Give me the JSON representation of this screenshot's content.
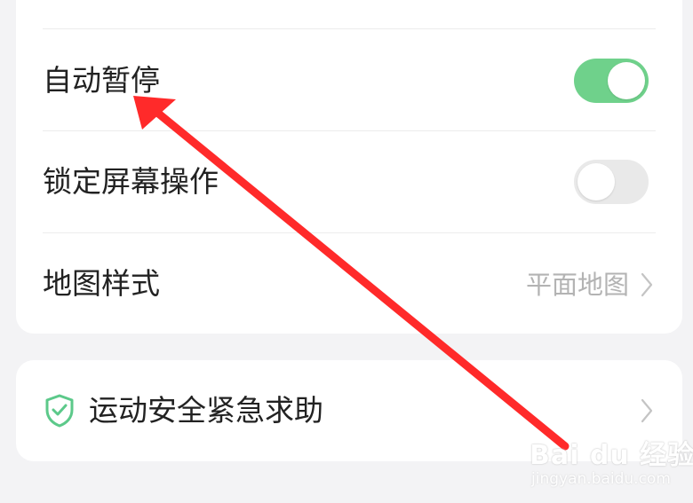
{
  "settings": {
    "auto_pause": {
      "label": "自动暂停",
      "enabled": true
    },
    "lock_screen": {
      "label": "锁定屏幕操作",
      "enabled": false
    },
    "map_style": {
      "label": "地图样式",
      "value": "平面地图"
    }
  },
  "safety": {
    "label": "运动安全紧急求助",
    "icon": "shield-check-icon"
  },
  "colors": {
    "toggle_on": "#6fd18b",
    "toggle_off": "#e9e9e9",
    "annotation_arrow": "#ff2a2a",
    "shield": "#5cc98a"
  },
  "watermark": {
    "main": "Bai du 经验",
    "sub": "jingyan.baidu.com"
  }
}
